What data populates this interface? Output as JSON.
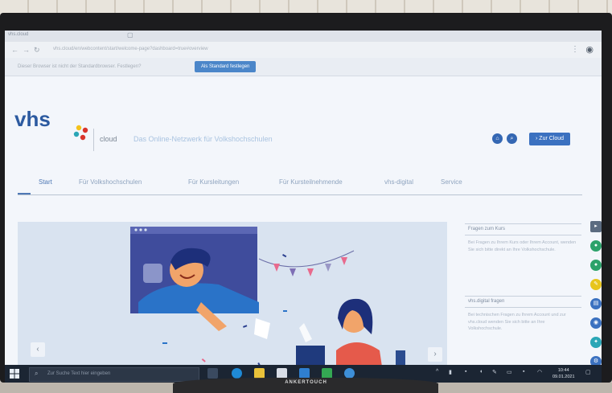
{
  "browser": {
    "tab_title": "vhs.cloud",
    "url": "vhs.cloud/en/webcontent/start/welcome-page?dashboard=true#overview",
    "infobar_text": "Dieser Browser ist nicht der Standardbrowser. Festlegen?",
    "infobar_button": "Als Standard festlegen"
  },
  "header": {
    "logo": "vhs",
    "cloud_label": "cloud",
    "subtitle": "Das Online-Netzwerk für Volkshochschulen",
    "cta_button": "Zur Cloud",
    "cta_icon": "arrow-right-icon"
  },
  "nav": {
    "items": [
      "Start",
      "Für Volkshochschulen",
      "Für Kursleitungen",
      "Für Kursteilnehmende",
      "vhs-digital",
      "Service"
    ]
  },
  "sidebar": {
    "section1_title": "Fragen zum Kurs",
    "section1_text": "Bei Fragen zu Ihrem Kurs oder Ihrem Account, wenden Sie sich bitte direkt an Ihre Volkshochschule.",
    "section2_title": "vhs.digital fragen",
    "section2_text": "Bei technischen Fragen zu Ihrem Account und zur vhs.cloud wenden Sie sich bitte an Ihre Volkshochschule."
  },
  "taskbar": {
    "search_placeholder": "Zur Suche Text hier eingeben",
    "time": "10:44",
    "date": "09.01.2021"
  },
  "monitor_brand": "ANKERTOUCH",
  "colors": {
    "accent": "#3b71c0",
    "logo_red": "#d9342b",
    "logo_yellow": "#f4c21b",
    "logo_teal": "#2aa6b6"
  }
}
